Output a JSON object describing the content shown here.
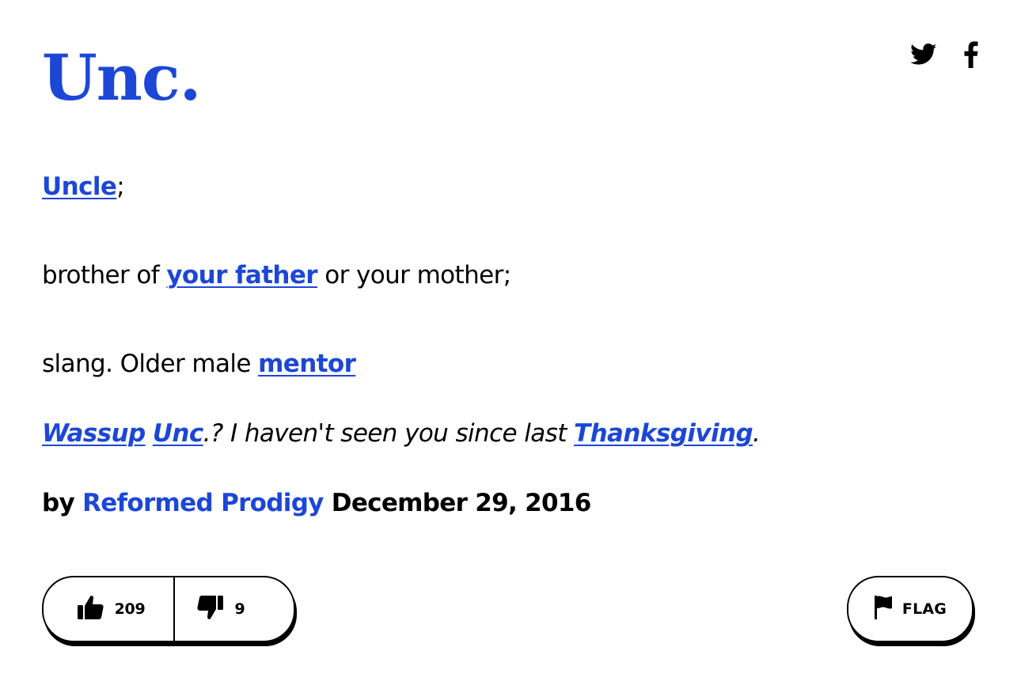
{
  "entry": {
    "word": "Unc.",
    "definition": {
      "line1": {
        "link": "Uncle",
        "after": ";"
      },
      "line2": {
        "before": "brother of ",
        "link": "your father",
        "after": " or your mother;"
      },
      "line3": {
        "before": "slang. Older male ",
        "link": "mentor"
      }
    },
    "example": {
      "link1": "Wassup",
      "space": " ",
      "link2": "Unc",
      "middle": ".? I haven't seen you since last ",
      "link3": "Thanksgiving",
      "end": "."
    },
    "byline": {
      "prefix": "by ",
      "author": "Reformed Prodigy",
      "date": " December 29, 2016"
    }
  },
  "votes": {
    "up_count": "209",
    "down_count": "9"
  },
  "flag": {
    "label": "FLAG"
  },
  "share": {
    "icons": [
      "twitter-icon",
      "facebook-icon"
    ]
  },
  "colors": {
    "link": "#1c47d6",
    "text": "#000000",
    "background": "#ffffff"
  }
}
